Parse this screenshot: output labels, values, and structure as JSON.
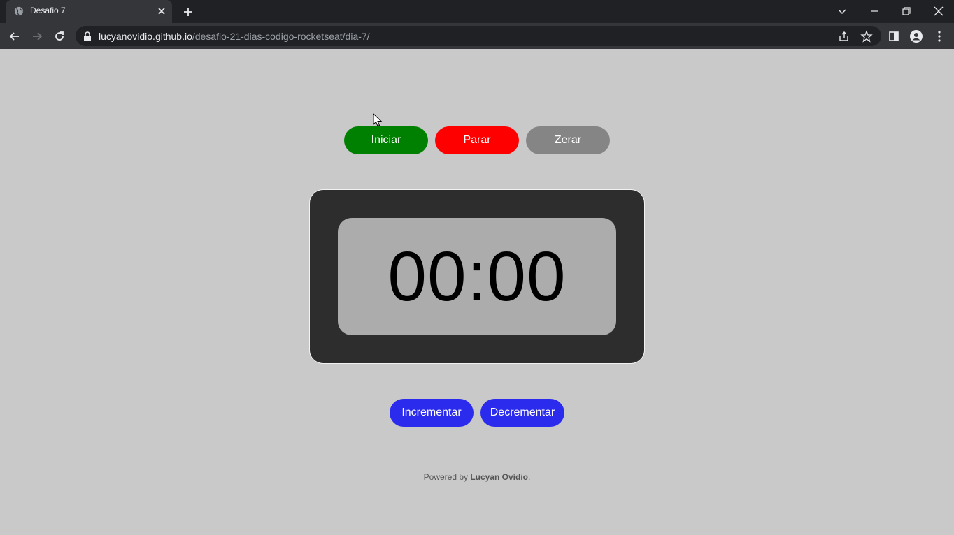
{
  "browser": {
    "tab_title": "Desafio 7",
    "url_host": "lucyanovidio.github.io",
    "url_path": "/desafio-21-dias-codigo-rocketseat/dia-7/"
  },
  "controls": {
    "start_label": "Iniciar",
    "stop_label": "Parar",
    "reset_label": "Zerar",
    "start_color": "#008000",
    "stop_color": "#ff0000",
    "reset_color": "#858585"
  },
  "timer": {
    "display": "00:00"
  },
  "adjust": {
    "increment_label": "Incrementar",
    "decrement_label": "Decrementar",
    "color": "#2b2bee"
  },
  "footer": {
    "prefix": "Powered by ",
    "author": "Lucyan Ovídio",
    "suffix": "."
  }
}
